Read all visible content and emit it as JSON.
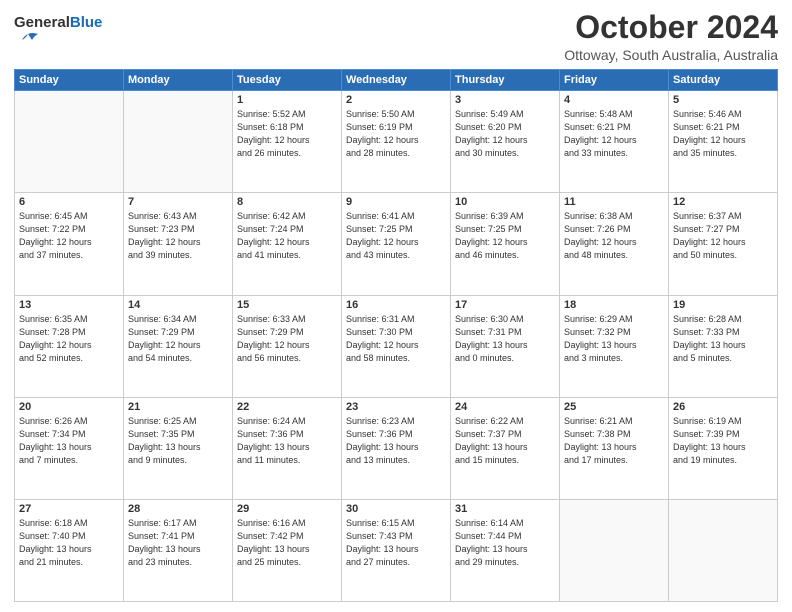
{
  "logo": {
    "general": "General",
    "blue": "Blue"
  },
  "header": {
    "month": "October 2024",
    "location": "Ottoway, South Australia, Australia"
  },
  "weekdays": [
    "Sunday",
    "Monday",
    "Tuesday",
    "Wednesday",
    "Thursday",
    "Friday",
    "Saturday"
  ],
  "weeks": [
    [
      {
        "day": "",
        "info": ""
      },
      {
        "day": "",
        "info": ""
      },
      {
        "day": "1",
        "info": "Sunrise: 5:52 AM\nSunset: 6:18 PM\nDaylight: 12 hours\nand 26 minutes."
      },
      {
        "day": "2",
        "info": "Sunrise: 5:50 AM\nSunset: 6:19 PM\nDaylight: 12 hours\nand 28 minutes."
      },
      {
        "day": "3",
        "info": "Sunrise: 5:49 AM\nSunset: 6:20 PM\nDaylight: 12 hours\nand 30 minutes."
      },
      {
        "day": "4",
        "info": "Sunrise: 5:48 AM\nSunset: 6:21 PM\nDaylight: 12 hours\nand 33 minutes."
      },
      {
        "day": "5",
        "info": "Sunrise: 5:46 AM\nSunset: 6:21 PM\nDaylight: 12 hours\nand 35 minutes."
      }
    ],
    [
      {
        "day": "6",
        "info": "Sunrise: 6:45 AM\nSunset: 7:22 PM\nDaylight: 12 hours\nand 37 minutes."
      },
      {
        "day": "7",
        "info": "Sunrise: 6:43 AM\nSunset: 7:23 PM\nDaylight: 12 hours\nand 39 minutes."
      },
      {
        "day": "8",
        "info": "Sunrise: 6:42 AM\nSunset: 7:24 PM\nDaylight: 12 hours\nand 41 minutes."
      },
      {
        "day": "9",
        "info": "Sunrise: 6:41 AM\nSunset: 7:25 PM\nDaylight: 12 hours\nand 43 minutes."
      },
      {
        "day": "10",
        "info": "Sunrise: 6:39 AM\nSunset: 7:25 PM\nDaylight: 12 hours\nand 46 minutes."
      },
      {
        "day": "11",
        "info": "Sunrise: 6:38 AM\nSunset: 7:26 PM\nDaylight: 12 hours\nand 48 minutes."
      },
      {
        "day": "12",
        "info": "Sunrise: 6:37 AM\nSunset: 7:27 PM\nDaylight: 12 hours\nand 50 minutes."
      }
    ],
    [
      {
        "day": "13",
        "info": "Sunrise: 6:35 AM\nSunset: 7:28 PM\nDaylight: 12 hours\nand 52 minutes."
      },
      {
        "day": "14",
        "info": "Sunrise: 6:34 AM\nSunset: 7:29 PM\nDaylight: 12 hours\nand 54 minutes."
      },
      {
        "day": "15",
        "info": "Sunrise: 6:33 AM\nSunset: 7:29 PM\nDaylight: 12 hours\nand 56 minutes."
      },
      {
        "day": "16",
        "info": "Sunrise: 6:31 AM\nSunset: 7:30 PM\nDaylight: 12 hours\nand 58 minutes."
      },
      {
        "day": "17",
        "info": "Sunrise: 6:30 AM\nSunset: 7:31 PM\nDaylight: 13 hours\nand 0 minutes."
      },
      {
        "day": "18",
        "info": "Sunrise: 6:29 AM\nSunset: 7:32 PM\nDaylight: 13 hours\nand 3 minutes."
      },
      {
        "day": "19",
        "info": "Sunrise: 6:28 AM\nSunset: 7:33 PM\nDaylight: 13 hours\nand 5 minutes."
      }
    ],
    [
      {
        "day": "20",
        "info": "Sunrise: 6:26 AM\nSunset: 7:34 PM\nDaylight: 13 hours\nand 7 minutes."
      },
      {
        "day": "21",
        "info": "Sunrise: 6:25 AM\nSunset: 7:35 PM\nDaylight: 13 hours\nand 9 minutes."
      },
      {
        "day": "22",
        "info": "Sunrise: 6:24 AM\nSunset: 7:36 PM\nDaylight: 13 hours\nand 11 minutes."
      },
      {
        "day": "23",
        "info": "Sunrise: 6:23 AM\nSunset: 7:36 PM\nDaylight: 13 hours\nand 13 minutes."
      },
      {
        "day": "24",
        "info": "Sunrise: 6:22 AM\nSunset: 7:37 PM\nDaylight: 13 hours\nand 15 minutes."
      },
      {
        "day": "25",
        "info": "Sunrise: 6:21 AM\nSunset: 7:38 PM\nDaylight: 13 hours\nand 17 minutes."
      },
      {
        "day": "26",
        "info": "Sunrise: 6:19 AM\nSunset: 7:39 PM\nDaylight: 13 hours\nand 19 minutes."
      }
    ],
    [
      {
        "day": "27",
        "info": "Sunrise: 6:18 AM\nSunset: 7:40 PM\nDaylight: 13 hours\nand 21 minutes."
      },
      {
        "day": "28",
        "info": "Sunrise: 6:17 AM\nSunset: 7:41 PM\nDaylight: 13 hours\nand 23 minutes."
      },
      {
        "day": "29",
        "info": "Sunrise: 6:16 AM\nSunset: 7:42 PM\nDaylight: 13 hours\nand 25 minutes."
      },
      {
        "day": "30",
        "info": "Sunrise: 6:15 AM\nSunset: 7:43 PM\nDaylight: 13 hours\nand 27 minutes."
      },
      {
        "day": "31",
        "info": "Sunrise: 6:14 AM\nSunset: 7:44 PM\nDaylight: 13 hours\nand 29 minutes."
      },
      {
        "day": "",
        "info": ""
      },
      {
        "day": "",
        "info": ""
      }
    ]
  ]
}
